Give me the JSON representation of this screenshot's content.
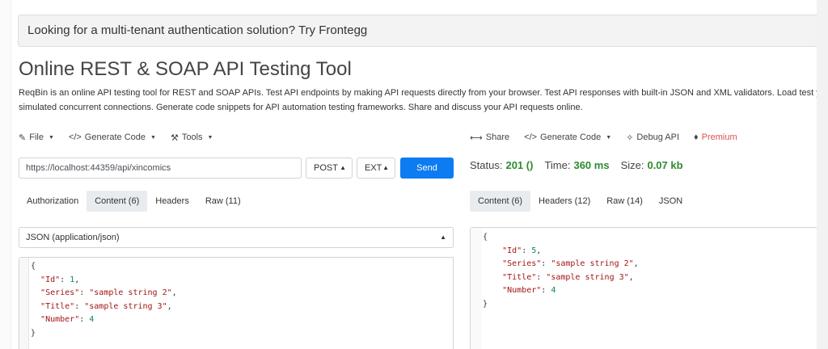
{
  "banner": {
    "text": "Looking for a multi-tenant authentication solution? Try Frontegg"
  },
  "page": {
    "title": "Online REST & SOAP API Testing Tool",
    "description_line1": "ReqBin is an online API testing tool for REST and SOAP APIs. Test API endpoints by making API requests directly from your browser. Test API responses with built-in JSON and XML validators. Load test your API w",
    "description_line2": "simulated concurrent connections. Generate code snippets for API automation testing frameworks. Share and discuss your API requests online."
  },
  "left_toolbar": {
    "file": "File",
    "generate_code": "Generate Code",
    "tools": "Tools"
  },
  "right_toolbar": {
    "share": "Share",
    "generate_code": "Generate Code",
    "debug_api": "Debug API",
    "premium": "Premium"
  },
  "request": {
    "url": "https://localhost:44359/api/xincomics",
    "method": "POST",
    "format": "EXT",
    "send": "Send",
    "tabs": [
      "Authorization",
      "Content (6)",
      "Headers",
      "Raw (11)"
    ],
    "active_tab": "Content (6)",
    "content_type": "JSON (application/json)"
  },
  "response": {
    "status_label": "Status:",
    "status_value": "201 ()",
    "time_label": "Time:",
    "time_value": "360 ms",
    "size_label": "Size:",
    "size_value": "0.07 kb",
    "tabs": [
      "Content (6)",
      "Headers (12)",
      "Raw (14)",
      "JSON"
    ],
    "active_tab": "Content (6)"
  },
  "request_body": {
    "line0": "{",
    "id_key": "\"Id\"",
    "id_val": "1",
    "series_key": "\"Series\"",
    "series_val": "\"sample string 2\"",
    "title_key": "\"Title\"",
    "title_val": "\"sample string 3\"",
    "number_key": "\"Number\"",
    "number_val": "4",
    "line_end": "}"
  },
  "response_body": {
    "line0": "{",
    "id_key": "\"Id\"",
    "id_val": "5",
    "series_key": "\"Series\"",
    "series_val": "\"sample string 2\"",
    "title_key": "\"Title\"",
    "title_val": "\"sample string 3\"",
    "number_key": "\"Number\"",
    "number_val": "4",
    "line_end": "}"
  },
  "colors": {
    "send_button": "#0d7bf2",
    "status_ok": "#2e8b2e",
    "premium": "#d9534f",
    "json_key": "#a31515",
    "json_number": "#098658"
  }
}
